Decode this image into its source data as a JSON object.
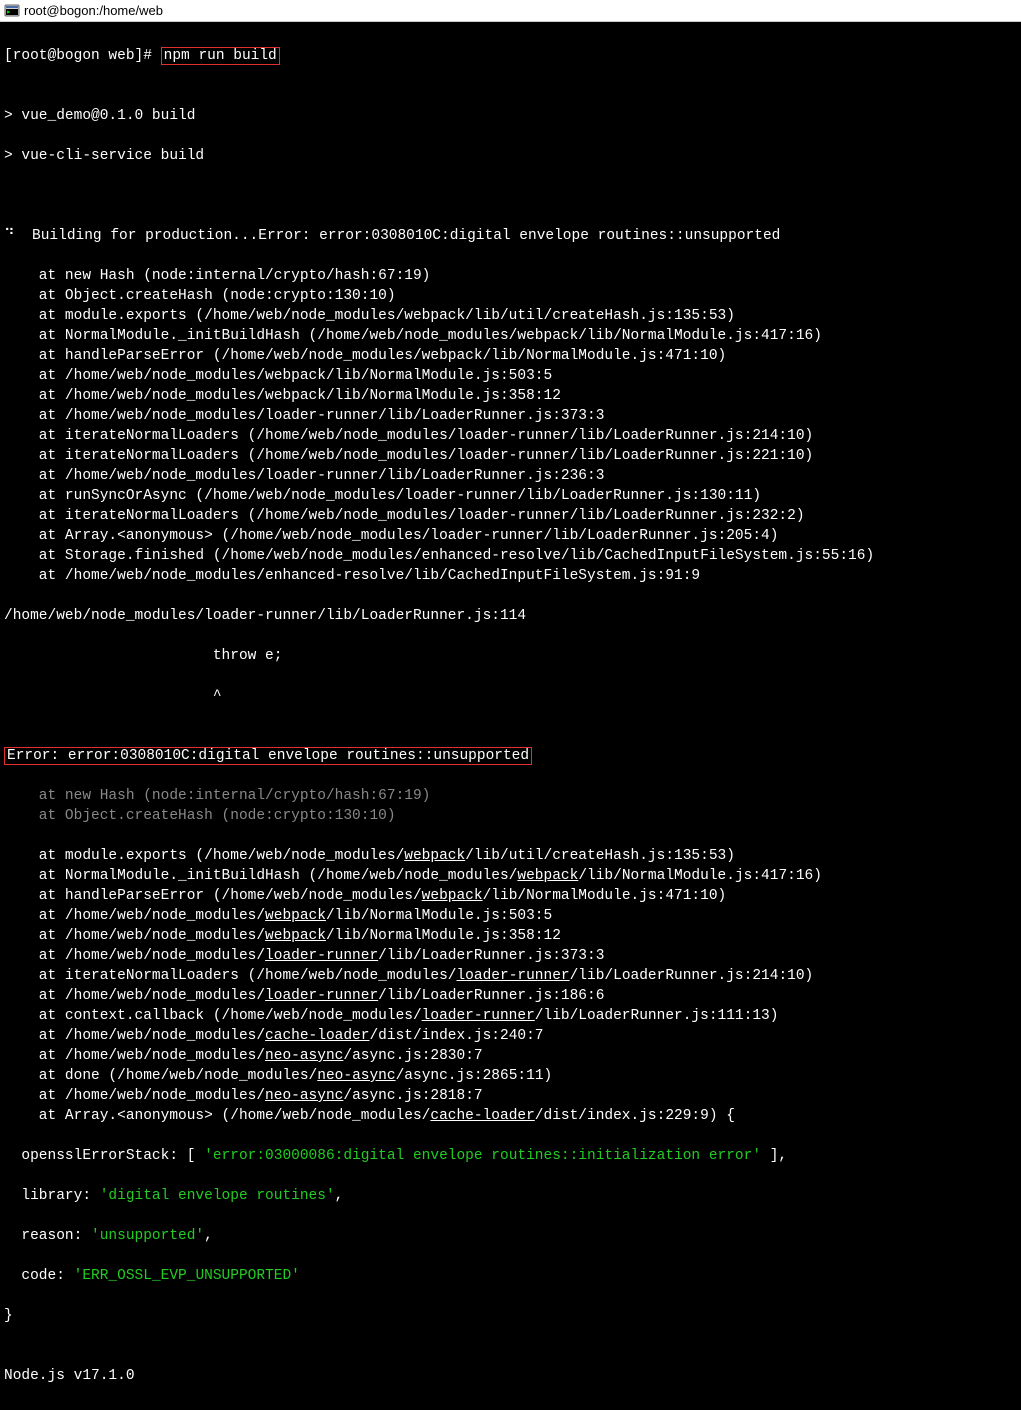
{
  "window": {
    "title": "root@bogon:/home/web"
  },
  "term": {
    "prompt_prefix": "[root@bogon web]# ",
    "command": "npm run build",
    "blank1": "",
    "line_build1": "> vue_demo@0.1.0 build",
    "line_build2": "> vue-cli-service build",
    "blank2": "",
    "blank3": "",
    "build_err_pre": "⠙  Building for production...Error: error:0308010C:digital envelope routines::unsupported",
    "stack1": [
      "    at new Hash (node:internal/crypto/hash:67:19)",
      "    at Object.createHash (node:crypto:130:10)",
      "    at module.exports (/home/web/node_modules/webpack/lib/util/createHash.js:135:53)",
      "    at NormalModule._initBuildHash (/home/web/node_modules/webpack/lib/NormalModule.js:417:16)",
      "    at handleParseError (/home/web/node_modules/webpack/lib/NormalModule.js:471:10)",
      "    at /home/web/node_modules/webpack/lib/NormalModule.js:503:5",
      "    at /home/web/node_modules/webpack/lib/NormalModule.js:358:12",
      "    at /home/web/node_modules/loader-runner/lib/LoaderRunner.js:373:3",
      "    at iterateNormalLoaders (/home/web/node_modules/loader-runner/lib/LoaderRunner.js:214:10)",
      "    at iterateNormalLoaders (/home/web/node_modules/loader-runner/lib/LoaderRunner.js:221:10)",
      "    at /home/web/node_modules/loader-runner/lib/LoaderRunner.js:236:3",
      "    at runSyncOrAsync (/home/web/node_modules/loader-runner/lib/LoaderRunner.js:130:11)",
      "    at iterateNormalLoaders (/home/web/node_modules/loader-runner/lib/LoaderRunner.js:232:2)",
      "    at Array.<anonymous> (/home/web/node_modules/loader-runner/lib/LoaderRunner.js:205:4)",
      "    at Storage.finished (/home/web/node_modules/enhanced-resolve/lib/CachedInputFileSystem.js:55:16)",
      "    at /home/web/node_modules/enhanced-resolve/lib/CachedInputFileSystem.js:91:9"
    ],
    "throw_path": "/home/web/node_modules/loader-runner/lib/LoaderRunner.js:114",
    "throw_line": "                        throw e;",
    "throw_caret": "                        ^",
    "blank4": "",
    "error_boxed": "Error: error:0308010C:digital envelope routines::unsupported",
    "dim_lines": [
      "    at new Hash (node:internal/crypto/hash:67:19)",
      "    at Object.createHash (node:crypto:130:10)"
    ],
    "stack2": [
      {
        "pre": "    at module.exports (/home/web/node_modules/",
        "ul": "webpack",
        "post": "/lib/util/createHash.js:135:53)"
      },
      {
        "pre": "    at NormalModule._initBuildHash (/home/web/node_modules/",
        "ul": "webpack",
        "post": "/lib/NormalModule.js:417:16)"
      },
      {
        "pre": "    at handleParseError (/home/web/node_modules/",
        "ul": "webpack",
        "post": "/lib/NormalModule.js:471:10)"
      },
      {
        "pre": "    at /home/web/node_modules/",
        "ul": "webpack",
        "post": "/lib/NormalModule.js:503:5"
      },
      {
        "pre": "    at /home/web/node_modules/",
        "ul": "webpack",
        "post": "/lib/NormalModule.js:358:12"
      },
      {
        "pre": "    at /home/web/node_modules/",
        "ul": "loader-runner",
        "post": "/lib/LoaderRunner.js:373:3"
      },
      {
        "pre": "    at iterateNormalLoaders (/home/web/node_modules/",
        "ul": "loader-runner",
        "post": "/lib/LoaderRunner.js:214:10)"
      },
      {
        "pre": "    at /home/web/node_modules/",
        "ul": "loader-runner",
        "post": "/lib/LoaderRunner.js:186:6"
      },
      {
        "pre": "    at context.callback (/home/web/node_modules/",
        "ul": "loader-runner",
        "post": "/lib/LoaderRunner.js:111:13)"
      },
      {
        "pre": "    at /home/web/node_modules/",
        "ul": "cache-loader",
        "post": "/dist/index.js:240:7"
      },
      {
        "pre": "    at /home/web/node_modules/",
        "ul": "neo-async",
        "post": "/async.js:2830:7"
      },
      {
        "pre": "    at done (/home/web/node_modules/",
        "ul": "neo-async",
        "post": "/async.js:2865:11)"
      },
      {
        "pre": "    at /home/web/node_modules/",
        "ul": "neo-async",
        "post": "/async.js:2818:7"
      },
      {
        "pre": "    at Array.<anonymous> (/home/web/node_modules/",
        "ul": "cache-loader",
        "post": "/dist/index.js:229:9) {"
      }
    ],
    "ossl_label": "  opensslErrorStack: [ ",
    "ossl_val": "'error:03000086:digital envelope routines::initialization error'",
    "ossl_tail": " ],",
    "lib_label": "  library: ",
    "lib_val": "'digital envelope routines'",
    "comma": ",",
    "reason_label": "  reason: ",
    "reason_val": "'unsupported'",
    "code_label": "  code: ",
    "code_val": "'ERR_OSSL_EVP_UNSUPPORTED'",
    "brace": "}",
    "blank5": "",
    "node_ver": "Node.js v17.1.0"
  }
}
